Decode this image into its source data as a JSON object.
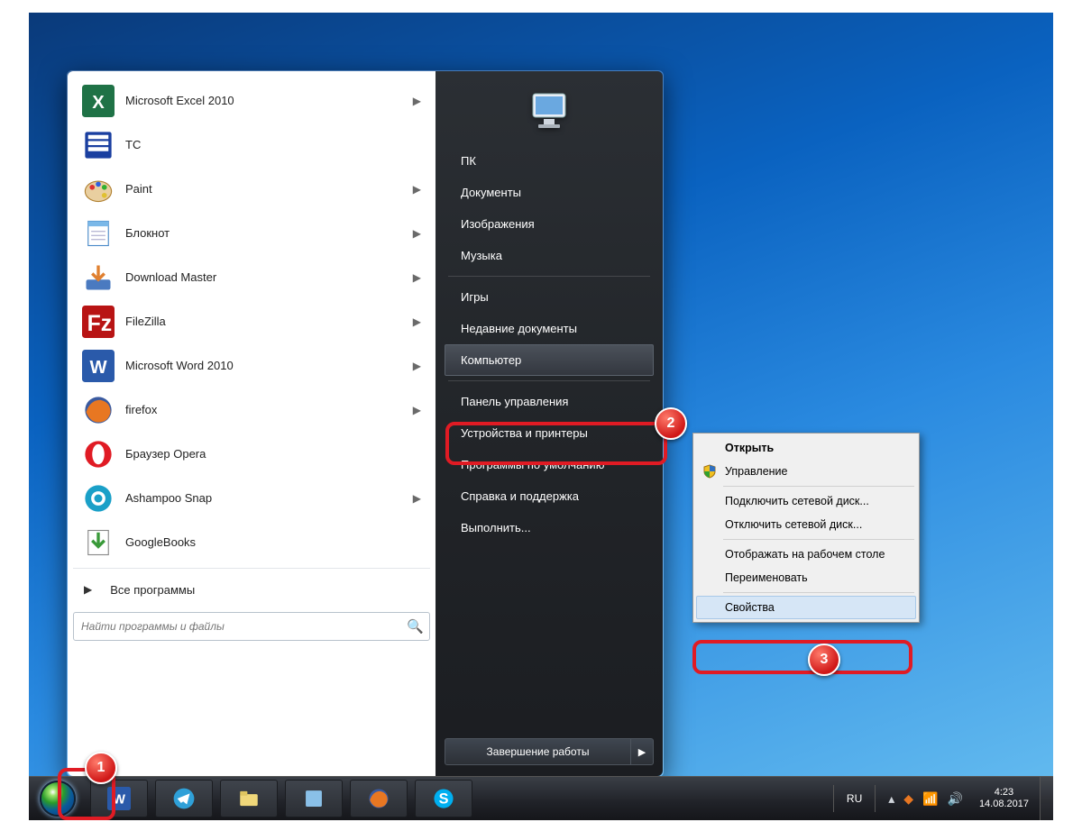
{
  "start_menu": {
    "programs": [
      {
        "label": "Microsoft Excel 2010",
        "arrow": true,
        "icon": "excel"
      },
      {
        "label": "TC",
        "arrow": false,
        "icon": "tc"
      },
      {
        "label": "Paint",
        "arrow": true,
        "icon": "paint"
      },
      {
        "label": "Блокнот",
        "arrow": true,
        "icon": "notepad"
      },
      {
        "label": "Download Master",
        "arrow": true,
        "icon": "dm"
      },
      {
        "label": "FileZilla",
        "arrow": true,
        "icon": "filezilla"
      },
      {
        "label": "Microsoft Word 2010",
        "arrow": true,
        "icon": "word"
      },
      {
        "label": "firefox",
        "arrow": true,
        "icon": "firefox"
      },
      {
        "label": "Браузер Opera",
        "arrow": false,
        "icon": "opera"
      },
      {
        "label": "Ashampoo Snap",
        "arrow": true,
        "icon": "snap"
      },
      {
        "label": "GoogleBooks",
        "arrow": false,
        "icon": "gbooks"
      }
    ],
    "all_programs": "Все программы",
    "search_placeholder": "Найти программы и файлы",
    "right_items_top": [
      "ПК",
      "Документы",
      "Изображения",
      "Музыка"
    ],
    "right_items_mid": [
      "Игры",
      "Недавние документы"
    ],
    "right_computer": "Компьютер",
    "right_items_bot": [
      "Панель управления",
      "Устройства и принтеры",
      "Программы по умолчанию",
      "Справка и поддержка",
      "Выполнить..."
    ],
    "shutdown": "Завершение работы"
  },
  "context_menu": {
    "open": "Открыть",
    "manage": "Управление",
    "map_drive": "Подключить сетевой диск...",
    "unmap_drive": "Отключить сетевой диск...",
    "show_desktop": "Отображать на рабочем столе",
    "rename": "Переименовать",
    "properties": "Свойства"
  },
  "taskbar": {
    "lang": "RU",
    "time": "4:23",
    "date": "14.08.2017"
  },
  "annotations": {
    "n1": "1",
    "n2": "2",
    "n3": "3"
  }
}
